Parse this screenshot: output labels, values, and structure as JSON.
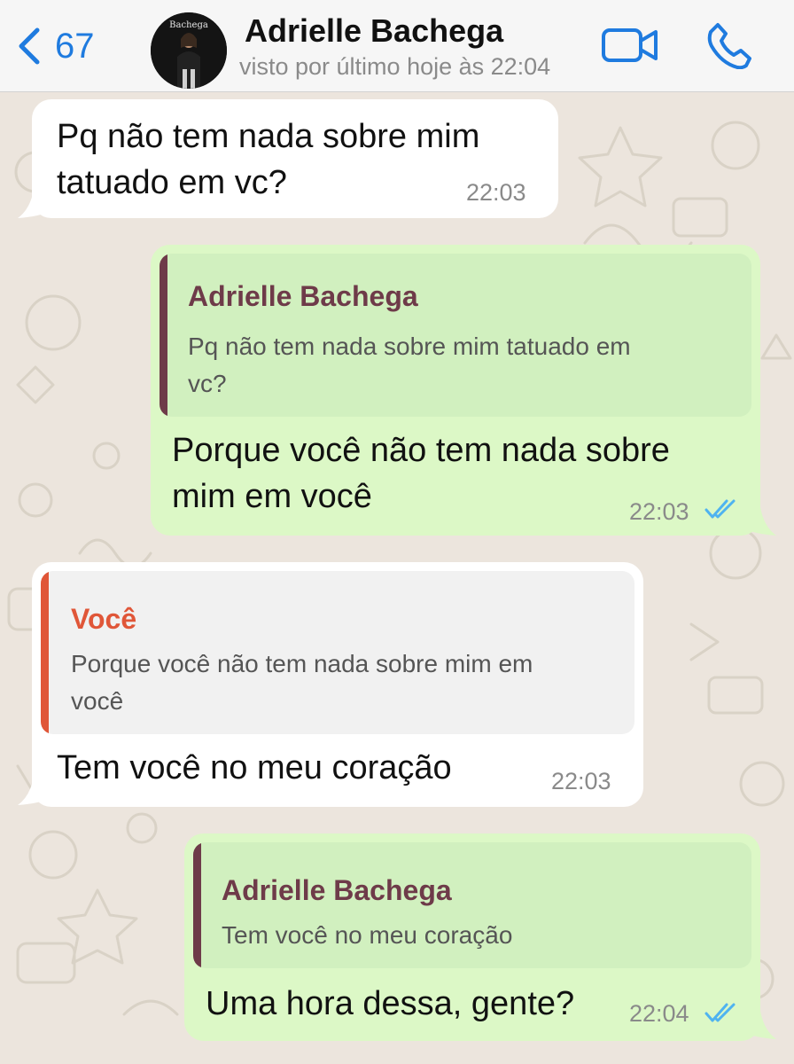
{
  "colors": {
    "accent_blue": "#1f7bdf",
    "outgoing_bubble": "#dcf8c6",
    "incoming_bubble": "#ffffff",
    "quote_author_contact": "#6e3b49",
    "quote_author_self": "#e05638",
    "read_ticks": "#4fb3f0"
  },
  "header": {
    "back_count": "67",
    "contact_name": "Adrielle Bachega",
    "status": "visto por último hoje às 22:04",
    "avatar_logo_text": "Bachega",
    "icons": [
      "chevron-left-icon",
      "video-camera-icon",
      "phone-icon"
    ]
  },
  "messages": [
    {
      "direction": "in",
      "lines": [
        "Pq não tem nada sobre mim",
        "tatuado em vc?"
      ],
      "time": "22:03"
    },
    {
      "direction": "out",
      "quote": {
        "author": "Adrielle Bachega",
        "lines": [
          "Pq não tem nada sobre mim tatuado em",
          "vc?"
        ]
      },
      "lines": [
        "Porque você não tem nada sobre",
        "mim em você"
      ],
      "time": "22:03",
      "status": "read"
    },
    {
      "direction": "in",
      "quote": {
        "author": "Você",
        "lines": [
          "Porque você não tem nada sobre mim em",
          "você"
        ]
      },
      "lines": [
        "Tem você no meu coração"
      ],
      "time": "22:03"
    },
    {
      "direction": "out",
      "quote": {
        "author": "Adrielle Bachega",
        "lines": [
          "Tem você no meu coração"
        ]
      },
      "lines": [
        "Uma hora dessa, gente?"
      ],
      "time": "22:04",
      "status": "read"
    }
  ]
}
